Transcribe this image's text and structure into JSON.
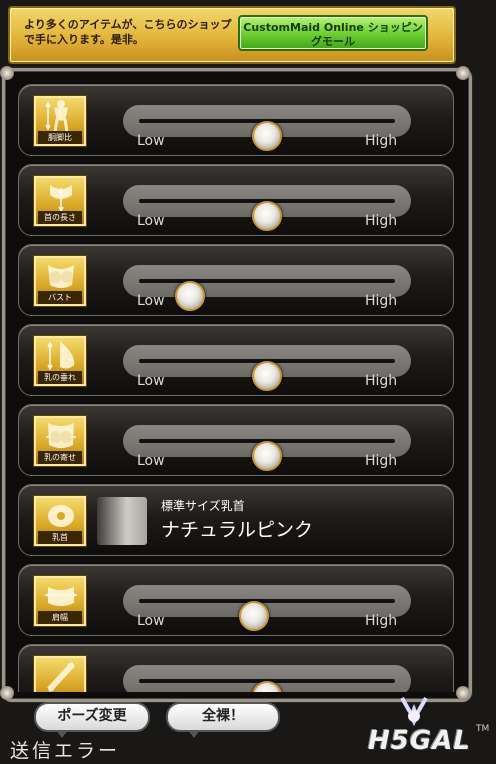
{
  "banner": {
    "text": "より多くのアイテムが、こちらのショップで手に入ります。是非。",
    "shop_button": "CustomMaid Online ショッピングモール"
  },
  "sliders": [
    {
      "label": "胴脚比",
      "low": "Low",
      "high": "High",
      "value": 0.5
    },
    {
      "label": "首の長さ",
      "low": "Low",
      "high": "High",
      "value": 0.5
    },
    {
      "label": "バスト",
      "low": "Low",
      "high": "High",
      "value": 0.2
    },
    {
      "label": "乳の垂れ",
      "low": "Low",
      "high": "High",
      "value": 0.5
    },
    {
      "label": "乳の寄せ",
      "low": "Low",
      "high": "High",
      "value": 0.5
    }
  ],
  "nipple": {
    "label": "乳首",
    "subtitle": "標準サイズ乳首",
    "name": "ナチュラルピンク"
  },
  "sliders2": [
    {
      "label": "肩幅",
      "low": "Low",
      "high": "High",
      "value": 0.45
    },
    {
      "label": "",
      "value": 0.5
    }
  ],
  "footer": {
    "pose_button": "ポーズ変更",
    "nude_button": "全裸！",
    "status": "送信エラー",
    "logo": "H5GAL",
    "tm": "TM"
  },
  "colors": {
    "accent_gold": "#d8a726",
    "shop_green": "#6fd134",
    "panel_bg": "#0e0d0c"
  }
}
